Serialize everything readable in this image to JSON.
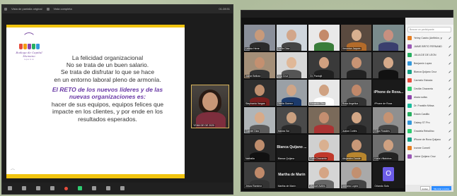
{
  "left_window": {
    "meeting_title": "Vista de pantalla original",
    "second_label": "Vista completa",
    "clock": "01:28:51",
    "slide": {
      "logo_line1": "Bodega de Capital Humano",
      "logo_line2": "Lujos & co",
      "lines": [
        "La felicidad organizacional",
        "No se trata de un buen salario.",
        "Se trata de disfrutar lo que se hace",
        "en un entorno laboral pleno de armonía."
      ],
      "highlight_lines": [
        "El RETO de los nuevos líderes y de las",
        "nuevas organizaciones es:"
      ],
      "body_lines": [
        "hacer de sus equipos, equipos felices que",
        "impacte en los clientes, y por ende en los",
        "resultados esperados."
      ]
    },
    "camera": {
      "label": "YEIMI DE DE 2020"
    },
    "dress_colors": [
      "#e74c3c",
      "#f39c12",
      "#8e44ad",
      "#27ae60",
      "#3498db"
    ]
  },
  "right_window": {
    "tiles": [
      {
        "name": "Leticia Herre",
        "skin": "#c89a7a",
        "bg": "#8a8f9a",
        "shirt": "#2b2b2b"
      },
      {
        "name": "CeSe.Diaz",
        "skin": "#d2a68a",
        "bg": "#cfd6dd",
        "shirt": "#444"
      },
      {
        "name": "",
        "skin": "#c48a6a",
        "bg": "#e9e9e9",
        "shirt": "#3a7d3a"
      },
      {
        "name": "Veronica Jaques",
        "skin": "#d8b090",
        "bg": "#5a4a3f",
        "shirt": "#b36b2a"
      },
      {
        "name": "",
        "skin": "#c89080",
        "bg": "#7a8b8c",
        "shirt": "#3a3f6e"
      },
      {
        "name": "Jaime Beltran",
        "skin": "#c49070",
        "bg": "#a48f78",
        "shirt": "#333"
      },
      {
        "name": "Ana Cruz",
        "skin": "#e0b898",
        "bg": "#d8d8d8",
        "shirt": "#555"
      },
      {
        "name": "Dr. Pantojit",
        "skin": "#d0a080",
        "bg": "#3a3a3a",
        "shirt": "#202020"
      },
      {
        "name": "",
        "skin": "#c89474",
        "bg": "#555",
        "shirt": "#222"
      },
      {
        "name": "",
        "skin": "#d6aa8a",
        "bg": "#444",
        "shirt": "#111"
      },
      {
        "name": "Stephania Vargas",
        "skin": "#bf8f6f",
        "bg": "#2f2f2f",
        "shirt": "#7a1f1f"
      },
      {
        "name": "Ofelia Gomez",
        "skin": "#cfa587",
        "bg": "#9aa0a6",
        "shirt": "#1c3a6b"
      },
      {
        "name": "Eduardo Oba",
        "skin": "#d0a282",
        "bg": "#e8e8e8",
        "shirt": "#fff"
      },
      {
        "name": "Rosa Angelica",
        "skin": "#c0886a",
        "bg": "#6b6b6b",
        "shirt": "#333"
      },
      {
        "name": "iPhone de Roxa",
        "skin": "",
        "bg": "#1a1a1a",
        "shirt": ""
      },
      {
        "name": "Gabriel Diaz",
        "skin": "#d8aa88",
        "bg": "#b0b5b8",
        "shirt": "#5a5a5a"
      },
      {
        "name": "Mariza Sol",
        "skin": "#caa080",
        "bg": "#4a4a4a",
        "shirt": "#2a2a2a"
      },
      {
        "name": "",
        "skin": "#c48e70",
        "bg": "#7a6a5a",
        "shirt": "#a33"
      },
      {
        "name": "Juana Cortés",
        "skin": "#d3a786",
        "bg": "#363636",
        "shirt": "#222"
      },
      {
        "name": "Erika Rosales",
        "skin": "#c69373",
        "bg": "#909090",
        "shirt": "#444"
      },
      {
        "name": "Nathalia",
        "skin": "#be8d6d",
        "bg": "#2a2a2a",
        "shirt": "#111"
      },
      {
        "name": "Blanca Quijano",
        "skin": "",
        "bg": "#1a1a1a",
        "shirt": ""
      },
      {
        "name": "Ruth Chavarria",
        "skin": "#d9b090",
        "bg": "#d0d0d0",
        "shirt": "#c0392b"
      },
      {
        "name": "Alejandra Zarate",
        "skin": "#c89878",
        "bg": "#3a3a3a",
        "shirt": "#b8862e"
      },
      {
        "name": "Karla Villalobos",
        "skin": "#cfa181",
        "bg": "#6f6f6f",
        "shirt": "#222"
      },
      {
        "name": "Jesus Ramirez",
        "skin": "#c08a6a",
        "bg": "#3e3e3e",
        "shirt": "#333"
      },
      {
        "name": "Martha de Marín",
        "skin": "",
        "bg": "#1a1a1a",
        "shirt": ""
      },
      {
        "name": "Manuel Aviles",
        "skin": "#d5a585",
        "bg": "#d5d5d5",
        "shirt": "#666"
      },
      {
        "name": "Adriana Lopez",
        "skin": "#c29070",
        "bg": "#a9a9a9",
        "shirt": "#444"
      },
      {
        "name": "Orlando Soto",
        "skin": "",
        "bg": "#1a1a1a",
        "shirt": ""
      }
    ],
    "bigname_tiles": {
      "14": "iPhone de Roxa...",
      "21": "Blanca Quijano ...",
      "26": "Martha de Marín"
    },
    "avatar_tile": {
      "index": 29,
      "letter": "O"
    },
    "participants": {
      "search_placeholder": "Buscar un participante",
      "rows": [
        {
          "name": "Yeimy Castro (Anfitrión, yo)",
          "color": "#e67e22"
        },
        {
          "name": "JAIME BRITO FERNANDEZ",
          "color": "#9b59b6"
        },
        {
          "name": "JULIA DE DE LEON",
          "color": "#27ae60"
        },
        {
          "name": "Benjamín Lopez",
          "color": "#3498db"
        },
        {
          "name": "Blanca Quijano Cruz",
          "color": "#16a085"
        },
        {
          "name": "Carmelo Estrada",
          "color": "#e74c3c"
        },
        {
          "name": "Cecilia Chavarria",
          "color": "#2ecc71"
        },
        {
          "name": "diocia soliss",
          "color": "#8e44ad"
        },
        {
          "name": "Dr. Franklin Mrksa",
          "color": "#1abc9c"
        },
        {
          "name": "Edwin Castillo",
          "color": "#27ae60"
        },
        {
          "name": "Galaxy S7 Pro",
          "color": "#3498db"
        },
        {
          "name": "Graciela Rebollino",
          "color": "#2ecc71"
        },
        {
          "name": "iPhone de Roxa Quijano",
          "color": "#16a085"
        },
        {
          "name": "Ivonne Cornell",
          "color": "#e67e22"
        },
        {
          "name": "Jaime Quijano Cruz",
          "color": "#9b59b6"
        }
      ],
      "invite_label": "Invitar",
      "mute_label": "Silenciar a todos"
    }
  }
}
